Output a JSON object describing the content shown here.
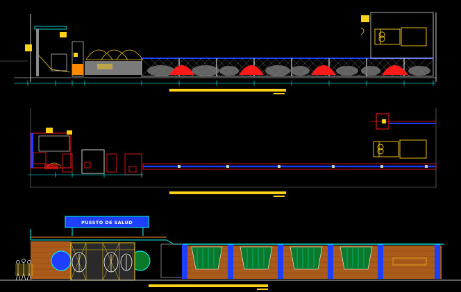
{
  "drawing": {
    "background": "#000000",
    "layers": {
      "wall": "#ffffff",
      "fence": "#c8c8c8",
      "mesh": "#8a8a8a",
      "accent_blue": "#1f3fff",
      "cyan": "#00ffff",
      "red": "#ff1a1a",
      "orange": "#ff8a00",
      "yellow": "#ffd21a",
      "brick": "#c86a1e",
      "green_panel": "#0a7a2a",
      "gray": "#7a7a7a"
    }
  },
  "elevation": {
    "sign_text": "PUESTO DE SALUD"
  },
  "icons": {
    "vehicle": "truck-icon",
    "people": "person-figure-icon",
    "tree": "tree-icon",
    "dome": "dome-icon"
  }
}
